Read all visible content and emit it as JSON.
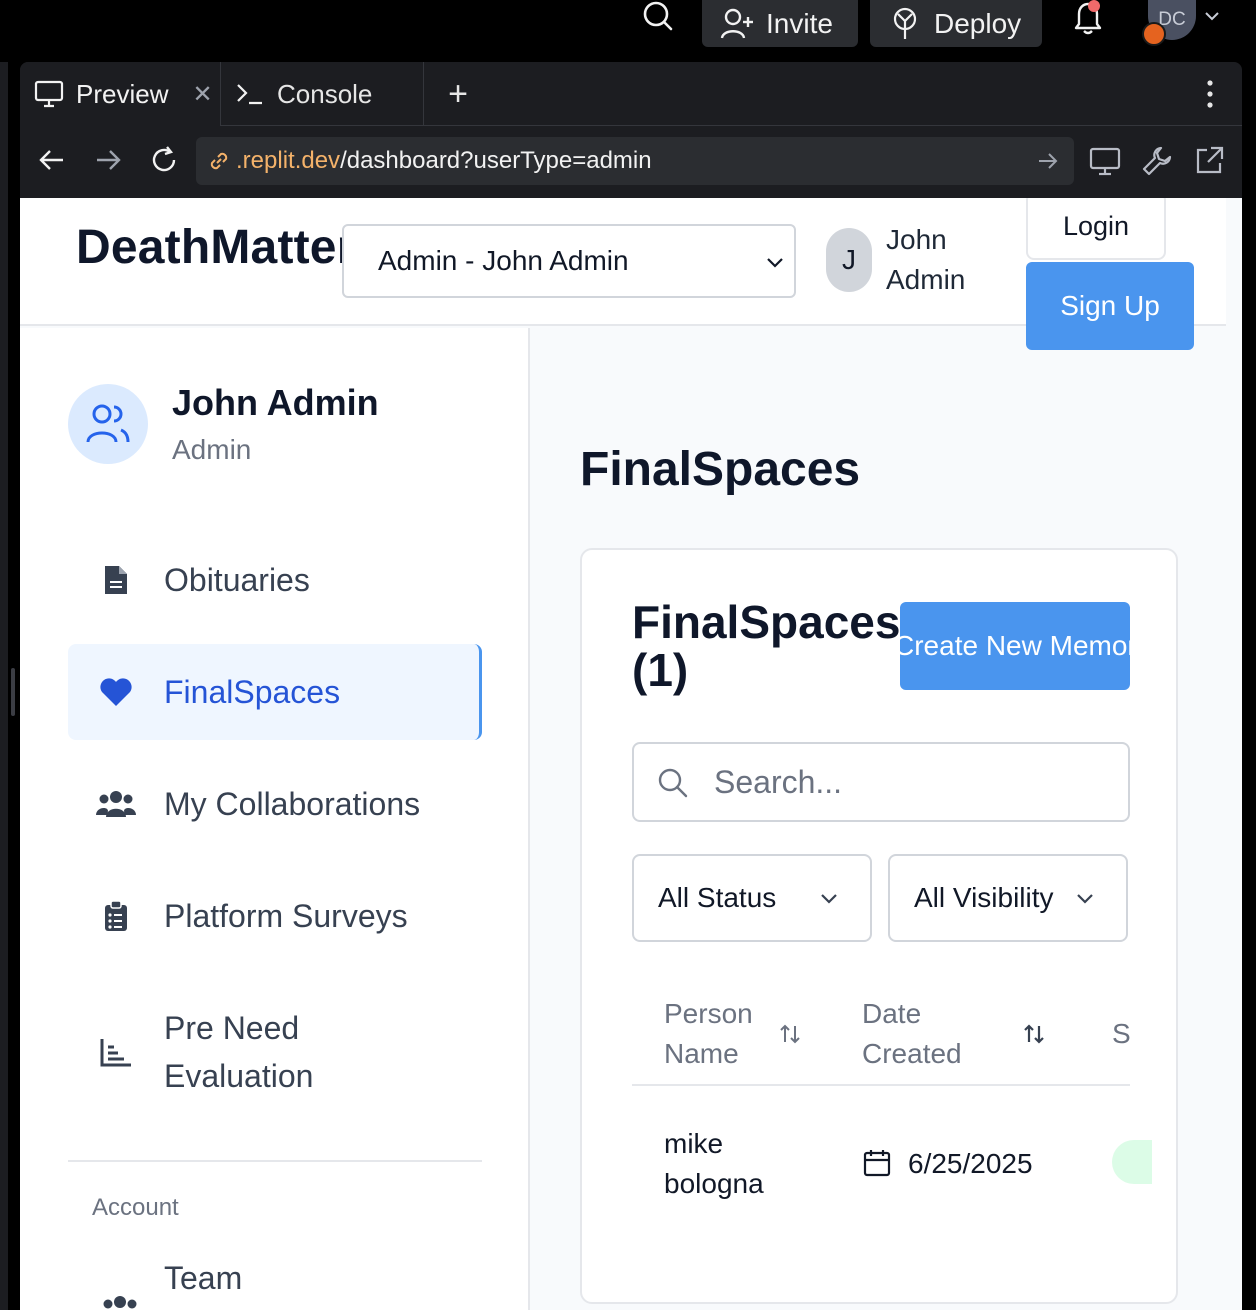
{
  "topbar": {
    "invite_label": "Invite",
    "deploy_label": "Deploy",
    "avatar_initials": "DC"
  },
  "tabs": [
    {
      "label": "Preview",
      "icon": "monitor-icon"
    },
    {
      "label": "Console",
      "icon": "terminal-icon"
    }
  ],
  "urlbar": {
    "host": ".replit.dev",
    "path": "/dashboard?userType=admin"
  },
  "app": {
    "brand": "DeathMatters",
    "user_select": {
      "selected": "Admin - John Admin"
    },
    "header_user": {
      "initial": "J",
      "name": "John Admin"
    },
    "login_label": "Login",
    "signup_label": "Sign Up"
  },
  "sidebar": {
    "user_name": "John Admin",
    "user_role": "Admin",
    "items": [
      {
        "label": "Obituaries",
        "icon": "document-icon"
      },
      {
        "label": "FinalSpaces",
        "icon": "heart-icon",
        "active": true
      },
      {
        "label": "My Collaborations",
        "icon": "users-icon"
      },
      {
        "label": "Platform Surveys",
        "icon": "clipboard-icon"
      },
      {
        "label": "Pre Need Evaluation",
        "icon": "bar-chart-icon"
      }
    ],
    "section_label": "Account",
    "team_label": "Team"
  },
  "main": {
    "title": "FinalSpaces",
    "card_title": "FinalSpaces (1)",
    "create_label": "Create New Memorial",
    "search_placeholder": "Search...",
    "status_filter": "All Status",
    "visibility_filter": "All Visibility",
    "columns": [
      "Person Name",
      "Date Created",
      "S"
    ],
    "rows": [
      {
        "name": "mike bologna",
        "date": "6/25/2025"
      }
    ]
  },
  "colors": {
    "accent": "#4a95ee",
    "active_text": "#2554d6",
    "active_bg": "#eff6ff"
  }
}
